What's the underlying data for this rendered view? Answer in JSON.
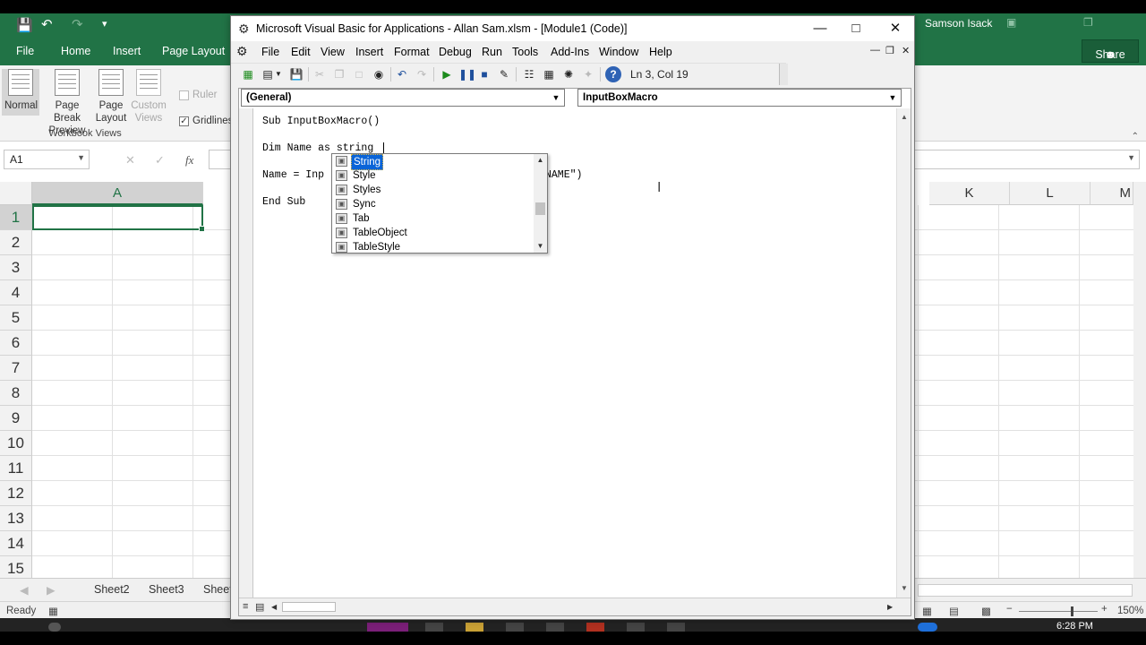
{
  "excel": {
    "user_name": "Samson Isack",
    "ribbon_tabs": [
      "File",
      "Home",
      "Insert",
      "Page Layout"
    ],
    "share_label": "Share",
    "workbook_views": {
      "normal": "Normal",
      "page_break_1": "Page Break",
      "page_break_2": "Preview",
      "page_layout_1": "Page",
      "page_layout_2": "Layout",
      "custom_views_1": "Custom",
      "custom_views_2": "Views",
      "group_label": "Workbook Views"
    },
    "ruler_label": "Ruler",
    "gridlines_label": "Gridlines",
    "name_box": "A1",
    "columns": [
      "A",
      "K",
      "L",
      "M"
    ],
    "rows": [
      "1",
      "2",
      "3",
      "4",
      "5",
      "6",
      "7",
      "8",
      "9",
      "10",
      "11",
      "12",
      "13",
      "14",
      "15"
    ],
    "sheet_tabs": [
      "Sheet2",
      "Sheet3",
      "Sheet"
    ],
    "status": "Ready",
    "zoom": "150%",
    "clock": "6:28 PM"
  },
  "vbe": {
    "title": "Microsoft Visual Basic for Applications - Allan Sam.xlsm - [Module1 (Code)]",
    "menus": [
      "File",
      "Edit",
      "View",
      "Insert",
      "Format",
      "Debug",
      "Run",
      "Tools",
      "Add-Ins",
      "Window",
      "Help"
    ],
    "cursor_position": "Ln 3, Col 19",
    "object_combo": "(General)",
    "procedure_combo": "InputBoxMacro",
    "code": {
      "line1": "Sub InputBoxMacro()",
      "line2": "Dim Name as string",
      "line3a": "Name = Inp",
      "line3b": "NAME\")",
      "line4": "End Sub"
    },
    "intellisense": {
      "items": [
        "String",
        "Style",
        "Styles",
        "Sync",
        "Tab",
        "TableObject",
        "TableStyle"
      ],
      "selected": "String"
    }
  }
}
